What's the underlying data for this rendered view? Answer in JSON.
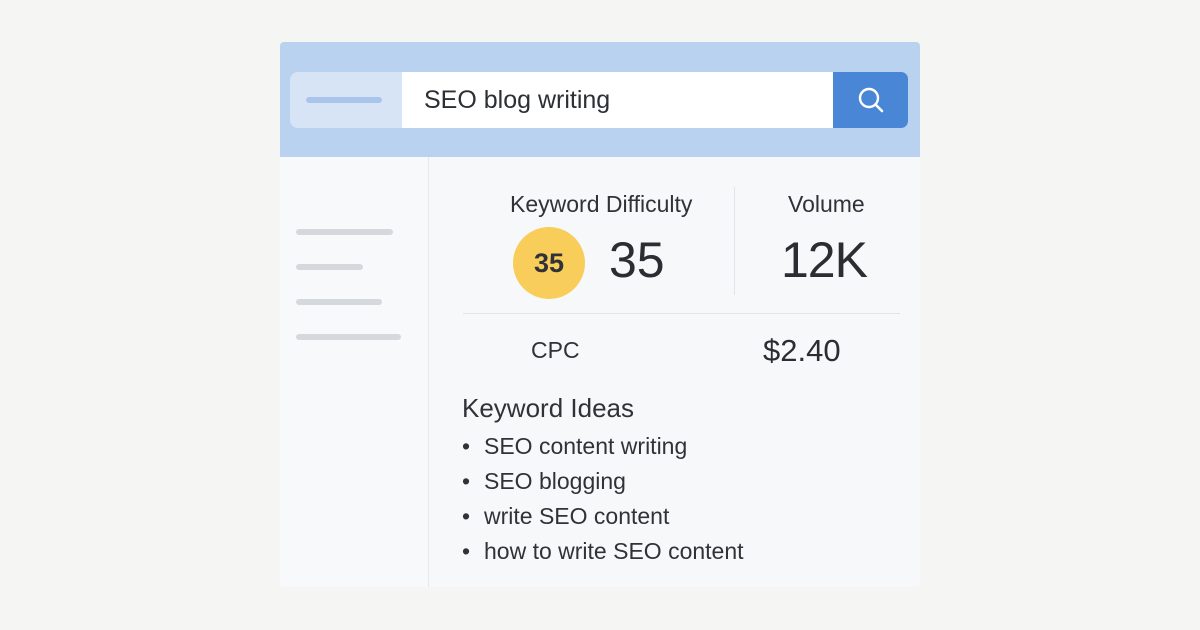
{
  "search": {
    "query": "SEO blog writing",
    "button_icon": "search-icon"
  },
  "metrics": {
    "keyword_difficulty": {
      "label": "Keyword Difficulty",
      "badge": "35",
      "value": "35",
      "badge_color": "#f8cd5a"
    },
    "volume": {
      "label": "Volume",
      "value": "12K"
    },
    "cpc": {
      "label": "CPC",
      "value": "$2.40"
    }
  },
  "keyword_ideas": {
    "title": "Keyword Ideas",
    "items": [
      "SEO content writing",
      "SEO blogging",
      "write SEO content",
      "how to write SEO content"
    ]
  },
  "colors": {
    "header_bg": "#b9d2ef",
    "accent": "#4a86d6",
    "page_bg": "#f5f5f4"
  }
}
